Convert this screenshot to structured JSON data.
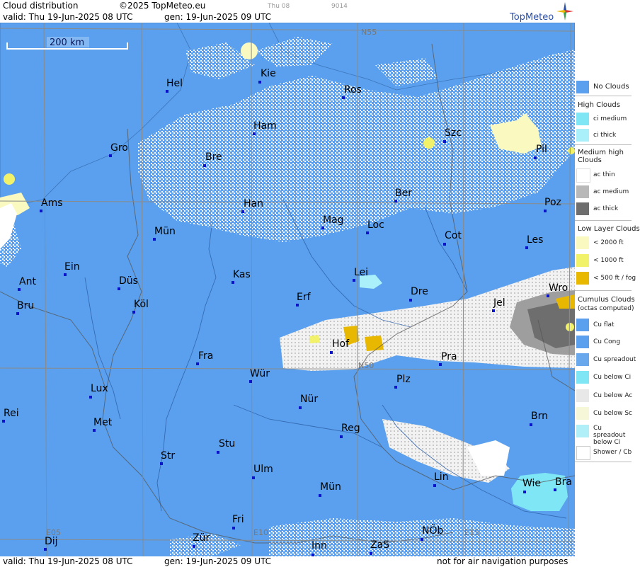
{
  "header": {
    "title": "Cloud distribution",
    "copyright": "©2025 TopMeteo.eu",
    "faint_time": "Thu 08",
    "faint_code": "9014",
    "valid": "valid:  Thu  19-Jun-2025  08 UTC",
    "generated": "gen: 19-Jun-2025 09 UTC",
    "logo": "TopMeteo"
  },
  "footer": {
    "valid": "valid:  Thu  19-Jun-2025  08 UTC",
    "generated": "gen: 19-Jun-2025 09 UTC",
    "disclaimer": "not for air navigation purposes"
  },
  "map": {
    "scale_label": "200 km",
    "grid_labels": [
      "N55",
      "N50",
      "E05",
      "E10",
      "E15"
    ],
    "cities": [
      "Hel",
      "Kie",
      "Ros",
      "Ham",
      "Szc",
      "Gro",
      "Bre",
      "Pil",
      "Ams",
      "Han",
      "Ber",
      "Poz",
      "Mün",
      "Mag",
      "Loc",
      "Cot",
      "Les",
      "Ein",
      "Kas",
      "Lei",
      "Ant",
      "Düs",
      "Dre",
      "Wro",
      "Bru",
      "Köl",
      "Erf",
      "Jel",
      "Hof",
      "Fra",
      "Pra",
      "Würz",
      "Plz",
      "Lux",
      "Nür",
      "Rei",
      "Met",
      "Reg",
      "Brn",
      "Stu",
      "Str",
      "Ulm",
      "Lin",
      "Wie",
      "Bra",
      "Mün2",
      "Fri",
      "NÖb",
      "Dij",
      "Zür",
      "Inn",
      "ZaS"
    ],
    "city_names": {
      "Hel": "Hel",
      "Kie": "Kie",
      "Ros": "Ros",
      "Ham": "Ham",
      "Szc": "Szc",
      "Gro": "Gro",
      "Bre": "Bre",
      "Pil": "Pil",
      "Ams": "Ams",
      "Han": "Han",
      "Ber": "Ber",
      "Poz": "Poz",
      "Mün": "Mün",
      "Mag": "Mag",
      "Loc": "Loc",
      "Cot": "Cot",
      "Les": "Les",
      "Ein": "Ein",
      "Kas": "Kas",
      "Lei": "Lei",
      "Ant": "Ant",
      "Düs": "Düs",
      "Dre": "Dre",
      "Wro": "Wro",
      "Bru": "Bru",
      "Köl": "Köl",
      "Erf": "Erf",
      "Jel": "Jel",
      "Hof": "Hof",
      "Fra": "Fra",
      "Pra": "Pra",
      "Würz": "Wür",
      "Plz": "Plz",
      "Lux": "Lux",
      "Nür": "Nür",
      "Rei": "Rei",
      "Met": "Met",
      "Reg": "Reg",
      "Brn": "Brn",
      "Stu": "Stu",
      "Str": "Str",
      "Ulm": "Ulm",
      "Lin": "Lin",
      "Wie": "Wie",
      "Bra": "Bra",
      "Mün2": "Mün",
      "Fri": "Fri",
      "NÖb": "NÖb",
      "Dij": "Dij",
      "Zür": "Zür",
      "Inn": "Inn",
      "ZaS": "ZaS"
    }
  },
  "legend": {
    "no_clouds": "No Clouds",
    "high_title": "High Clouds",
    "ci_medium": "ci medium",
    "ci_thick": "ci thick",
    "medium_title": "Medium high Clouds",
    "ac_thin": "ac thin",
    "ac_medium": "ac medium",
    "ac_thick": "ac thick",
    "low_title": "Low Layer Clouds",
    "low_2000": "< 2000 ft",
    "low_1000": "< 1000 ft",
    "low_500": "< 500 ft / fog",
    "cu_title": "Cumulus Clouds",
    "cu_subtitle": "(octas computed)",
    "cu_flat": "Cu flat",
    "cu_cong": "Cu Cong",
    "cu_spreadout": "Cu spreadout",
    "cu_below_ci": "Cu below Ci",
    "cu_below_ac": "Cu below Ac",
    "cu_below_sc": "Cu below Sc",
    "cu_spreadout_below_ci": "Cu spreadout below Ci",
    "shower": "Shower / Cb"
  },
  "colors": {
    "no_clouds": "#5aa0ee",
    "grid": "#8a8a8a",
    "ci_medium": "#7fe6f5",
    "ci_thick": "#a9f0fa",
    "ac_thin": "#ffffff",
    "ac_medium": "#b8b8b8",
    "ac_thick": "#6e6e6e",
    "low_2000": "#fafac0",
    "low_1000": "#f2f26a",
    "low_500": "#e8b800",
    "city": "#0a14c8"
  }
}
